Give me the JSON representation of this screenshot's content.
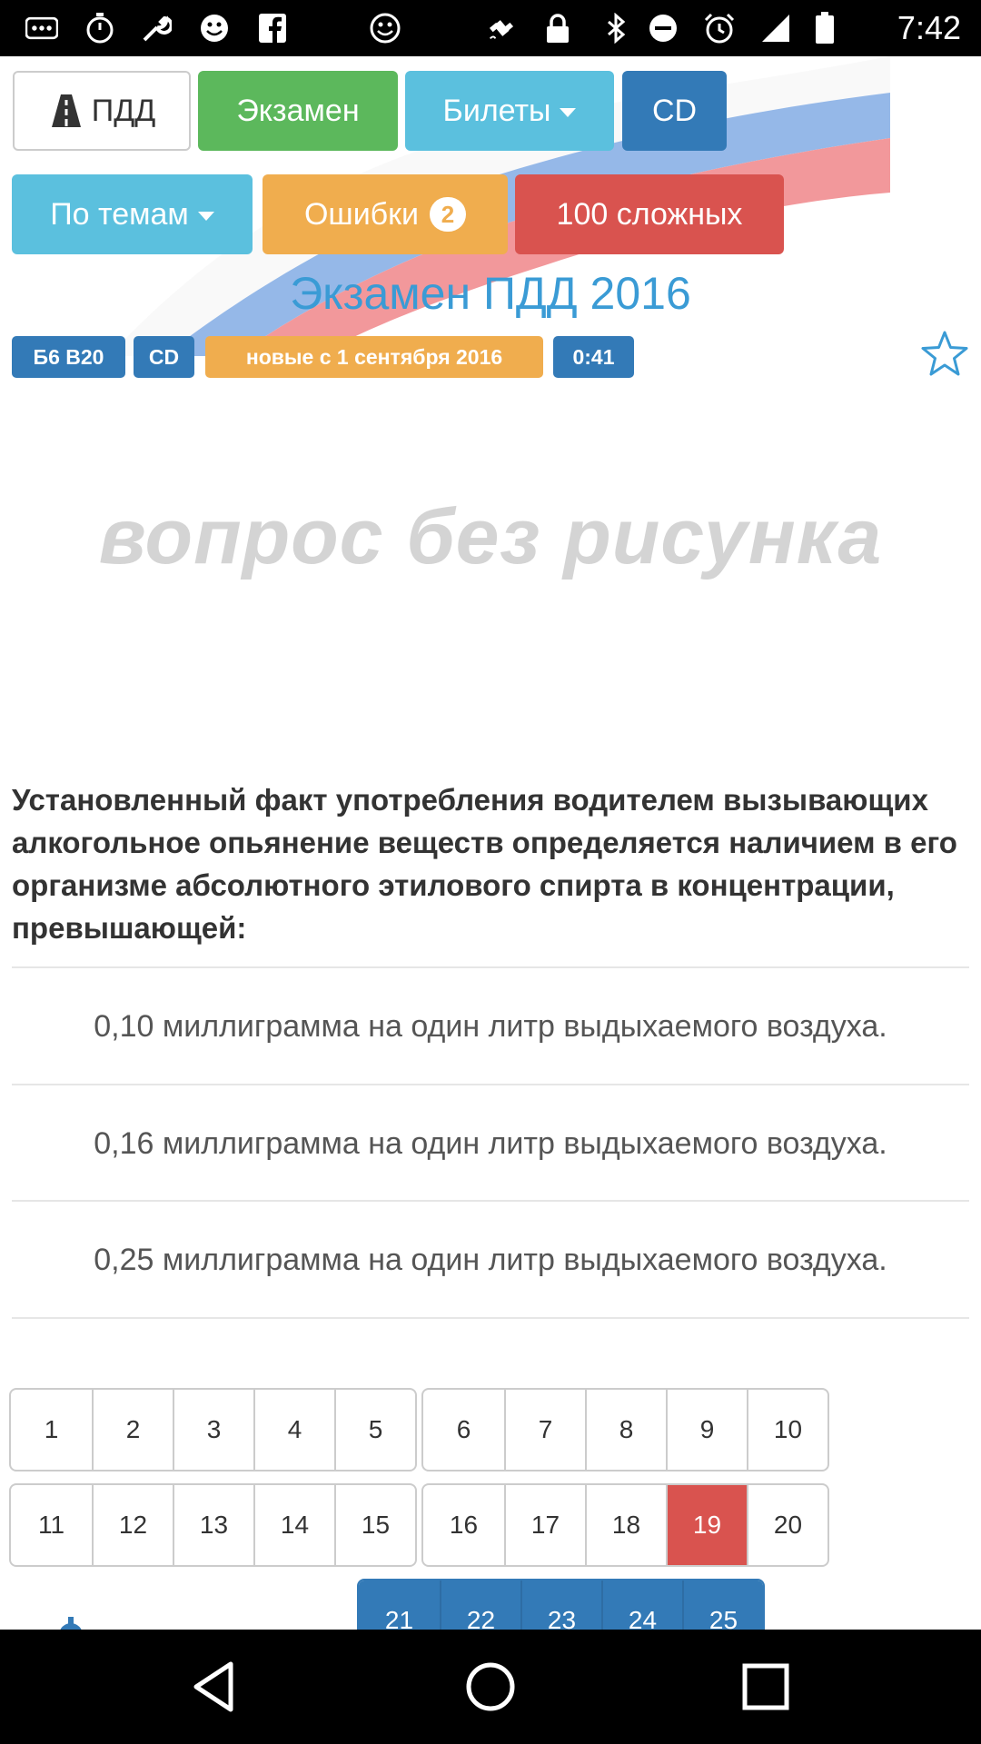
{
  "status_bar": {
    "time": "7:42",
    "icons": [
      "more-icon",
      "timer-icon",
      "wrench-icon",
      "smiley-icon",
      "facebook-icon",
      "smiley-icon",
      "fake-gps-icon",
      "lock-icon",
      "bluetooth-icon",
      "minus-circle-icon",
      "alarm-icon",
      "signal-icon",
      "battery-icon"
    ]
  },
  "nav_top": {
    "pdd_label": "ПДД",
    "exam_label": "Экзамен",
    "tickets_label": "Билеты",
    "cd_label": "CD"
  },
  "nav_second": {
    "topics_label": "По темам",
    "errors_label": "Ошибки",
    "errors_count": "2",
    "hard_label": "100 сложных"
  },
  "page_title": "Экзамен ПДД 2016",
  "labels": {
    "ticket": "Б6 В20",
    "category": "CD",
    "new_notice": "новые с 1 сентября 2016",
    "timer": "0:41"
  },
  "no_picture_text": "вопрос без рисунка",
  "question": "Установленный факт употребления водителем вызывающих алкогольное опьянение веществ определяется наличием в его организме абсолютного этилового спирта в концентрации, превышающей:",
  "answers": [
    "0,10 миллиграмма на один литр выдыхаемого воздуха.",
    "0,16 миллиграмма на один литр выдыхаемого воздуха.",
    "0,25 миллиграмма на один литр выдыхаемого воздуха."
  ],
  "pagination": {
    "row1a": [
      "1",
      "2",
      "3",
      "4",
      "5"
    ],
    "row1b": [
      "6",
      "7",
      "8",
      "9",
      "10"
    ],
    "row2a": [
      "11",
      "12",
      "13",
      "14",
      "15"
    ],
    "row2b": [
      "16",
      "17",
      "18",
      "19",
      "20"
    ],
    "row3": [
      "21",
      "22",
      "23",
      "24",
      "25"
    ],
    "active": "19"
  },
  "colors": {
    "success": "#5cb85c",
    "info": "#5bc0de",
    "primary": "#337ab7",
    "warning": "#f0ad4e",
    "danger": "#d9534f",
    "title": "#3a9bd5"
  }
}
